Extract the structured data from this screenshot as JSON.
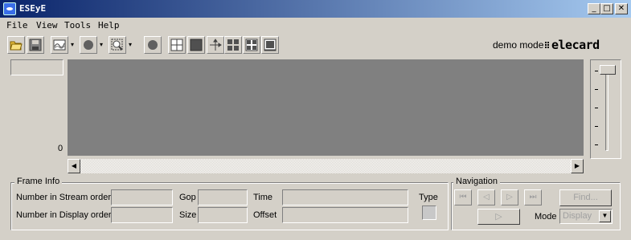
{
  "window": {
    "title": "ESEyE",
    "minimize": "_",
    "maximize": "□",
    "close": "✕"
  },
  "menu": [
    "File",
    "View",
    "Tools",
    "Help"
  ],
  "toolbar": {
    "icons": [
      "open-folder-icon",
      "save-icon",
      "waveform-icon",
      "record-icon",
      "zoom-icon",
      "circle-icon",
      "grid-icon",
      "block-icon",
      "move-icon",
      "grid-4-icon",
      "grid-2-icon",
      "grid-lines-icon"
    ],
    "mode_text": "demo mode",
    "logo_text": "elecard"
  },
  "viewer": {
    "label_value": "",
    "axis_zero": "0"
  },
  "frame_info": {
    "title": "Frame Info",
    "stream_order_label": "Number in Stream order",
    "stream_order_value": "",
    "display_order_label": "Number in Display order",
    "display_order_value": "",
    "gop_label": "Gop",
    "gop_value": "",
    "size_label": "Size",
    "size_value": "",
    "time_label": "Time",
    "time_value": "",
    "offset_label": "Offset",
    "offset_value": "",
    "type_label": "Type"
  },
  "navigation": {
    "title": "Navigation",
    "first": "⏮",
    "prev": "◁",
    "next": "▷",
    "last": "⏭",
    "play": "▷",
    "find": "Find...",
    "mode_label": "Mode",
    "mode_value": "Display"
  }
}
